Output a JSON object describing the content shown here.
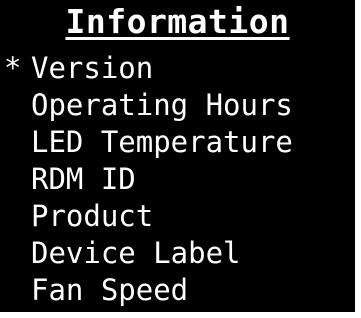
{
  "screen": {
    "title": "Information",
    "cursor_glyph": "*",
    "selected_index": 0,
    "items": [
      {
        "label": "Version"
      },
      {
        "label": "Operating Hours"
      },
      {
        "label": "LED Temperature"
      },
      {
        "label": "RDM ID"
      },
      {
        "label": "Product"
      },
      {
        "label": "Device Label"
      },
      {
        "label": "Fan Speed"
      }
    ]
  },
  "colors": {
    "background": "#000000",
    "text": "#ffffff"
  }
}
